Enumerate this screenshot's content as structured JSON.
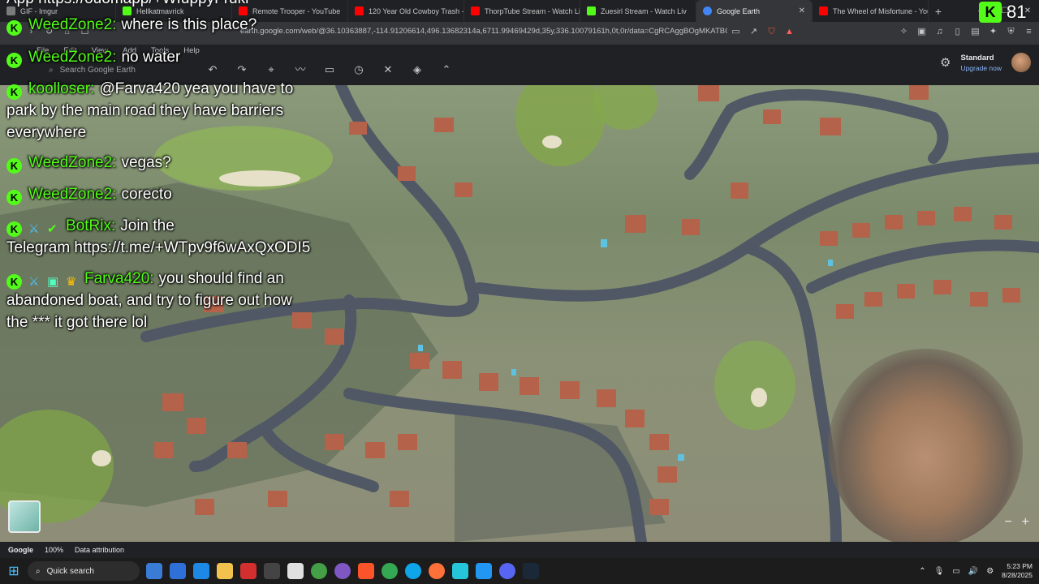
{
  "browser": {
    "tabs": [
      {
        "label": "GIF - Imgur",
        "color": "#7b7b7b"
      },
      {
        "label": "Hellkatmavrick",
        "color": "#53fc18"
      },
      {
        "label": "Remote Trooper - YouTube",
        "color": "#ff0000"
      },
      {
        "label": "120 Year Old Cowboy Trash - Y",
        "color": "#ff0000"
      },
      {
        "label": "ThorpTube Stream - Watch Liv",
        "color": "#ff0000"
      },
      {
        "label": "Zuesirl Stream - Watch Liv",
        "color": "#53fc18"
      },
      {
        "label": "Google Earth",
        "color": "#4285f4",
        "active": true
      },
      {
        "label": "The Wheel of Misfortune - You",
        "color": "#ff0000"
      }
    ],
    "url": "earth.google.com/web/@36.10363887,-114.91206614,496.13682314a,6711.99469429d,35y,336.10079161h,0t,0r/data=CgRCAggBOgMKATBCAg...",
    "top_right_overlay": "81"
  },
  "earth": {
    "menus": [
      "File",
      "Edit",
      "View",
      "Add",
      "Tools",
      "Help"
    ],
    "search_placeholder": "Search Google Earth",
    "plan_label": "Standard",
    "upgrade_label": "Upgrade now",
    "status": {
      "brand": "Google",
      "zoom": "100%",
      "attribution": "Data attribution"
    }
  },
  "chat": {
    "top_cut": "App https://ouomapp/+WfuppyFrukr",
    "messages": [
      {
        "user": "WeedZone2:",
        "text": "where is this place?"
      },
      {
        "user": "WeedZone2:",
        "text": "no water"
      },
      {
        "user": "koolloser:",
        "text": "@Farva420 yea you have to",
        "cont": [
          "park by the main road they have barriers",
          "everywhere"
        ]
      },
      {
        "user": "WeedZone2:",
        "text": "vegas?"
      },
      {
        "user": "WeedZone2:",
        "text": "corecto"
      },
      {
        "user": "BotRix:",
        "text": "Join the",
        "cont": [
          "Telegram https://t.me/+WTpv9f6wAxQxODI5"
        ]
      },
      {
        "user": "Farva420:",
        "text": "you should find an",
        "cont": [
          "abandoned boat, and try to figure out how",
          "the *** it got there lol"
        ]
      }
    ]
  },
  "taskbar": {
    "search_label": "Quick search",
    "time": "5:23 PM",
    "date": "8/28/2025"
  }
}
